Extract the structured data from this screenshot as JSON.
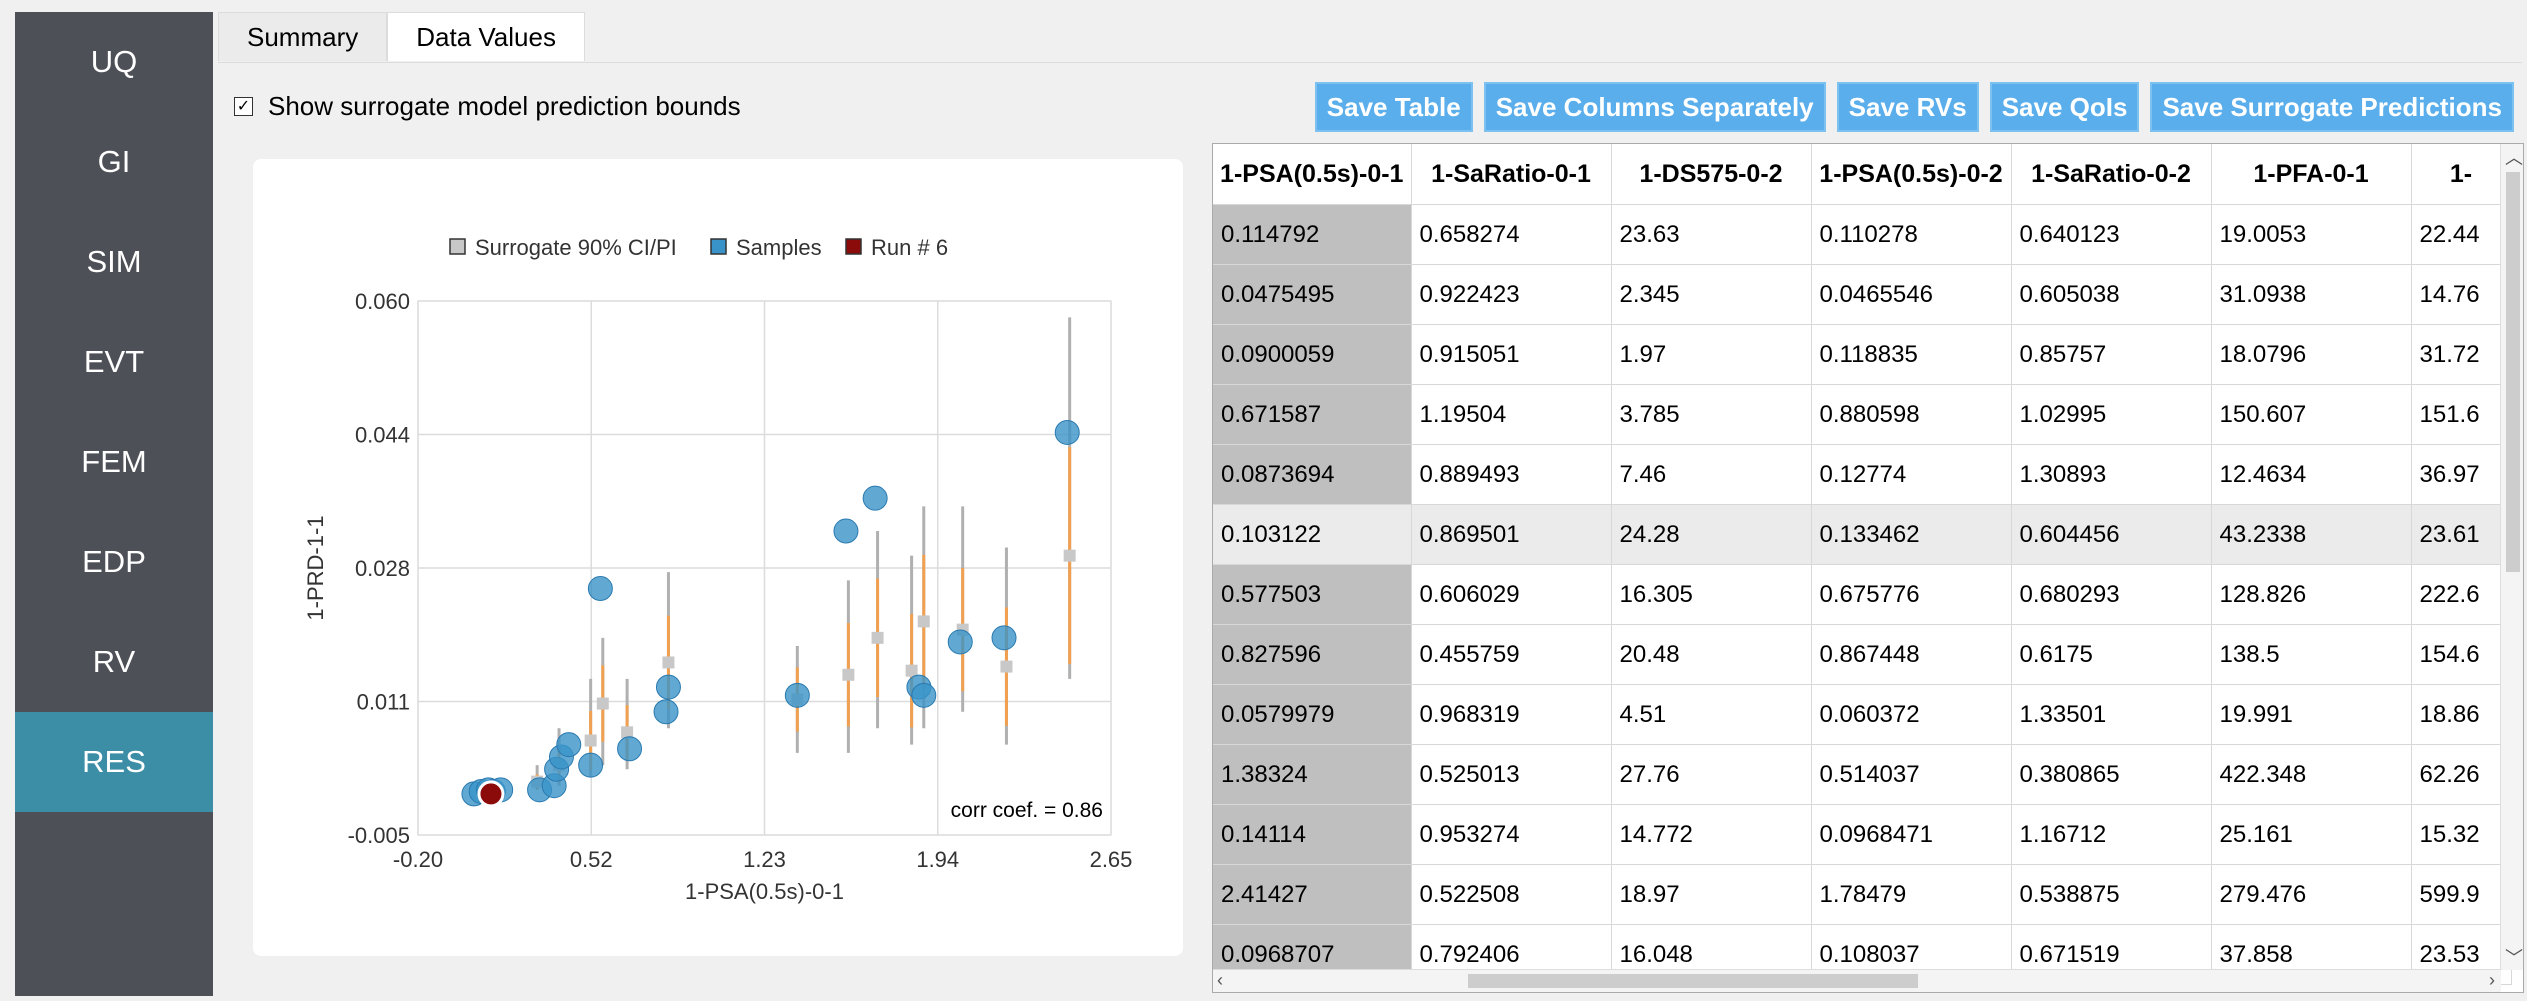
{
  "sidebar": {
    "items": [
      {
        "label": "UQ"
      },
      {
        "label": "GI"
      },
      {
        "label": "SIM"
      },
      {
        "label": "EVT"
      },
      {
        "label": "FEM"
      },
      {
        "label": "EDP"
      },
      {
        "label": "RV"
      },
      {
        "label": "RES"
      }
    ],
    "active": "RES"
  },
  "tabs": [
    {
      "label": "Summary"
    },
    {
      "label": "Data Values"
    }
  ],
  "active_tab": "Data Values",
  "checkbox": {
    "label": "Show surrogate model prediction bounds",
    "checked": true
  },
  "buttons": {
    "save_table": "Save Table",
    "save_columns": "Save Columns Separately",
    "save_rvs": "Save RVs",
    "save_qois": "Save QoIs",
    "save_surrogate": "Save Surrogate Predictions"
  },
  "colors": {
    "accent": "#3c8ea6",
    "button": "#5aaeeb",
    "samples": "#3a93c8",
    "run": "#8b0a0a",
    "ci_box": "#c8c8c8",
    "ci_bar": "#f0a050"
  },
  "chart_data": {
    "type": "scatter",
    "xlabel": "1-PSA(0.5s)-0-1",
    "ylabel": "1-PRD-1-1",
    "xlim": [
      -0.2,
      2.65
    ],
    "ylim": [
      -0.005,
      0.06
    ],
    "xticks": [
      "-0.20",
      "0.52",
      "1.23",
      "1.94",
      "2.65"
    ],
    "yticks": [
      "0.060",
      "0.044",
      "0.028",
      "0.011",
      "-0.005"
    ],
    "legend": [
      {
        "name": "Surrogate 90% CI/PI"
      },
      {
        "name": "Samples"
      },
      {
        "name": "Run # 6"
      }
    ],
    "legend_position": "top",
    "grid": true,
    "annotation": "corr coef. = 0.86",
    "samples": [
      {
        "x": 0.03,
        "y": 0.0
      },
      {
        "x": 0.06,
        "y": 0.0003
      },
      {
        "x": 0.09,
        "y": 0.0005
      },
      {
        "x": 0.11,
        "y": 0.0003
      },
      {
        "x": 0.14,
        "y": 0.0005
      },
      {
        "x": 0.3,
        "y": 0.0005
      },
      {
        "x": 0.36,
        "y": 0.001
      },
      {
        "x": 0.37,
        "y": 0.003
      },
      {
        "x": 0.39,
        "y": 0.0045
      },
      {
        "x": 0.42,
        "y": 0.006
      },
      {
        "x": 0.51,
        "y": 0.0035
      },
      {
        "x": 0.55,
        "y": 0.025
      },
      {
        "x": 0.67,
        "y": 0.0055
      },
      {
        "x": 0.82,
        "y": 0.01
      },
      {
        "x": 0.83,
        "y": 0.013
      },
      {
        "x": 1.36,
        "y": 0.012
      },
      {
        "x": 1.56,
        "y": 0.032
      },
      {
        "x": 1.68,
        "y": 0.036
      },
      {
        "x": 1.86,
        "y": 0.013
      },
      {
        "x": 1.88,
        "y": 0.012
      },
      {
        "x": 2.03,
        "y": 0.0185
      },
      {
        "x": 2.21,
        "y": 0.019
      },
      {
        "x": 2.47,
        "y": 0.044
      }
    ],
    "run": {
      "x": 0.1,
      "y": 0.0
    },
    "intervals": [
      {
        "x": 0.29,
        "y": 0.0015,
        "lo": 0.0005,
        "hi": 0.0035
      },
      {
        "x": 0.38,
        "y": 0.0035,
        "lo": 0.001,
        "hi": 0.008
      },
      {
        "x": 0.51,
        "y": 0.0065,
        "lo": 0.002,
        "hi": 0.014
      },
      {
        "x": 0.56,
        "y": 0.011,
        "lo": 0.0035,
        "hi": 0.019
      },
      {
        "x": 0.66,
        "y": 0.0075,
        "lo": 0.003,
        "hi": 0.014
      },
      {
        "x": 0.83,
        "y": 0.016,
        "lo": 0.008,
        "hi": 0.027
      },
      {
        "x": 1.36,
        "y": 0.0115,
        "lo": 0.005,
        "hi": 0.018
      },
      {
        "x": 1.57,
        "y": 0.0145,
        "lo": 0.005,
        "hi": 0.026
      },
      {
        "x": 1.69,
        "y": 0.019,
        "lo": 0.008,
        "hi": 0.032
      },
      {
        "x": 1.83,
        "y": 0.015,
        "lo": 0.006,
        "hi": 0.029
      },
      {
        "x": 1.88,
        "y": 0.021,
        "lo": 0.008,
        "hi": 0.035
      },
      {
        "x": 2.04,
        "y": 0.02,
        "lo": 0.01,
        "hi": 0.035
      },
      {
        "x": 2.22,
        "y": 0.0155,
        "lo": 0.006,
        "hi": 0.03
      },
      {
        "x": 2.48,
        "y": 0.029,
        "lo": 0.014,
        "hi": 0.058
      }
    ]
  },
  "table": {
    "columns": [
      "1-PSA(0.5s)-0-1",
      "1-SaRatio-0-1",
      "1-DS575-0-2",
      "1-PSA(0.5s)-0-2",
      "1-SaRatio-0-2",
      "1-PFA-0-1",
      "1-"
    ],
    "rows": [
      [
        "0.114792",
        "0.658274",
        "23.63",
        "0.110278",
        "0.640123",
        "19.0053",
        "22.44"
      ],
      [
        "0.0475495",
        "0.922423",
        "2.345",
        "0.0465546",
        "0.605038",
        "31.0938",
        "14.76"
      ],
      [
        "0.0900059",
        "0.915051",
        "1.97",
        "0.118835",
        "0.85757",
        "18.0796",
        "31.72"
      ],
      [
        "0.671587",
        "1.19504",
        "3.785",
        "0.880598",
        "1.02995",
        "150.607",
        "151.6"
      ],
      [
        "0.0873694",
        "0.889493",
        "7.46",
        "0.12774",
        "1.30893",
        "12.4634",
        "36.97"
      ],
      [
        "0.103122",
        "0.869501",
        "24.28",
        "0.133462",
        "0.604456",
        "43.2338",
        "23.61"
      ],
      [
        "0.577503",
        "0.606029",
        "16.305",
        "0.675776",
        "0.680293",
        "128.826",
        "222.6"
      ],
      [
        "0.827596",
        "0.455759",
        "20.48",
        "0.867448",
        "0.6175",
        "138.5",
        "154.6"
      ],
      [
        "0.0579979",
        "0.968319",
        "4.51",
        "0.060372",
        "1.33501",
        "19.991",
        "18.86"
      ],
      [
        "1.38324",
        "0.525013",
        "27.76",
        "0.514037",
        "0.380865",
        "422.348",
        "62.26"
      ],
      [
        "0.14114",
        "0.953274",
        "14.772",
        "0.0968471",
        "1.16712",
        "25.161",
        "15.32"
      ],
      [
        "2.41427",
        "0.522508",
        "18.97",
        "1.78479",
        "0.538875",
        "279.476",
        "599.9"
      ],
      [
        "0.0968707",
        "0.792406",
        "16.048",
        "0.108037",
        "0.671519",
        "37.858",
        "23.53"
      ]
    ],
    "highlighted_row": 5
  }
}
